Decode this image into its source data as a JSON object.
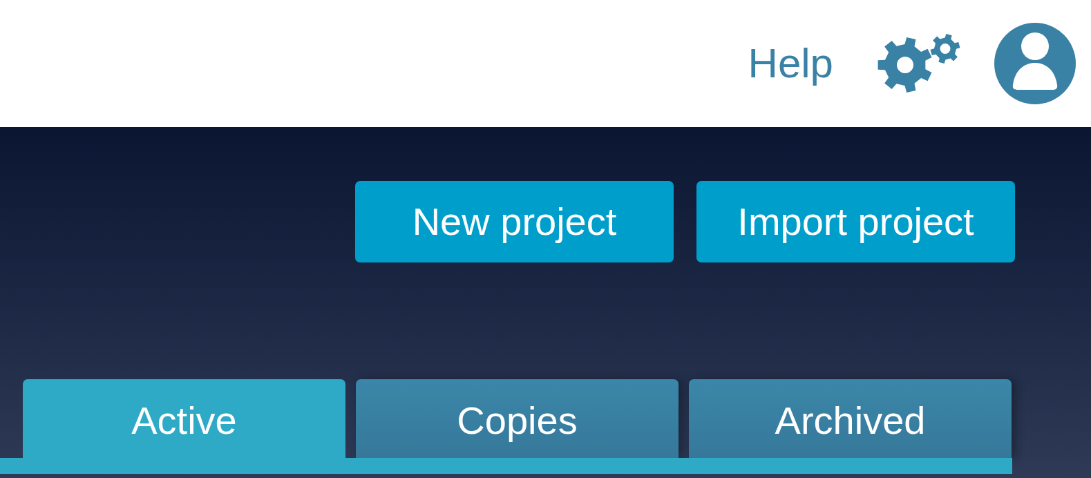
{
  "header": {
    "help_link": "Help"
  },
  "actions": [
    "New project",
    "Import project"
  ],
  "tabs": [
    {
      "label": "Active",
      "selected": true
    },
    {
      "label": "Copies",
      "selected": false
    },
    {
      "label": "Archived",
      "selected": false
    }
  ]
}
